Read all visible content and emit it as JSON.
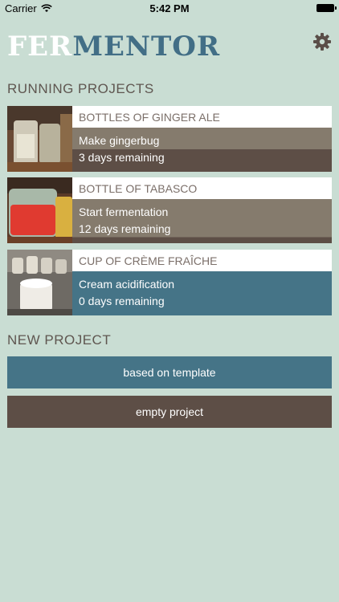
{
  "status_bar": {
    "carrier": "Carrier",
    "time": "5:42 PM"
  },
  "header": {
    "logo_part1": "FER",
    "logo_part2": "MENTOR",
    "settings_icon": "gear-icon"
  },
  "running": {
    "title": "RUNNING PROJECTS",
    "projects": [
      {
        "title": "BOTTLES OF GINGER ALE",
        "step": "Make gingerbug",
        "remaining": "3 days remaining"
      },
      {
        "title": "BOTTLE OF TABASCO",
        "step": "Start fermentation",
        "remaining": "12 days remaining"
      },
      {
        "title": "CUP OF CRÈME FRAÎCHE",
        "step": "Cream acidification",
        "remaining": "0 days remaining"
      }
    ]
  },
  "new_project": {
    "title": "NEW PROJECT",
    "template_button": "based on template",
    "empty_button": "empty project"
  },
  "colors": {
    "background": "#c9ddd3",
    "blue": "#457487",
    "brown": "#5d4e46",
    "olive": "#857b6d"
  }
}
